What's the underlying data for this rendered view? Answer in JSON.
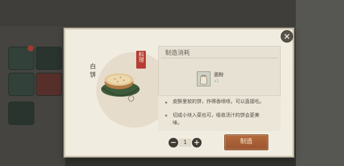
{
  "dialog": {
    "close_label": "×"
  },
  "dish": {
    "name": "白饼",
    "stamp": "料理"
  },
  "cost": {
    "title": "制造消耗",
    "ingredient": {
      "name": "面粉",
      "quantity": "x1"
    }
  },
  "description": {
    "line1": "皮酥里软的饼，炸得香喷喷，可以直接吃。",
    "line2": "切成小块入菜也可，吸收汤汁的饼会更美",
    "line3": "味。"
  },
  "stepper": {
    "minus": "−",
    "value": "1",
    "plus": "+"
  },
  "actions": {
    "make_label": "制造"
  },
  "colors": {
    "accent_button": "#a85f35",
    "stamp_red": "#b63c33",
    "panel_bg": "#f1ece0"
  }
}
